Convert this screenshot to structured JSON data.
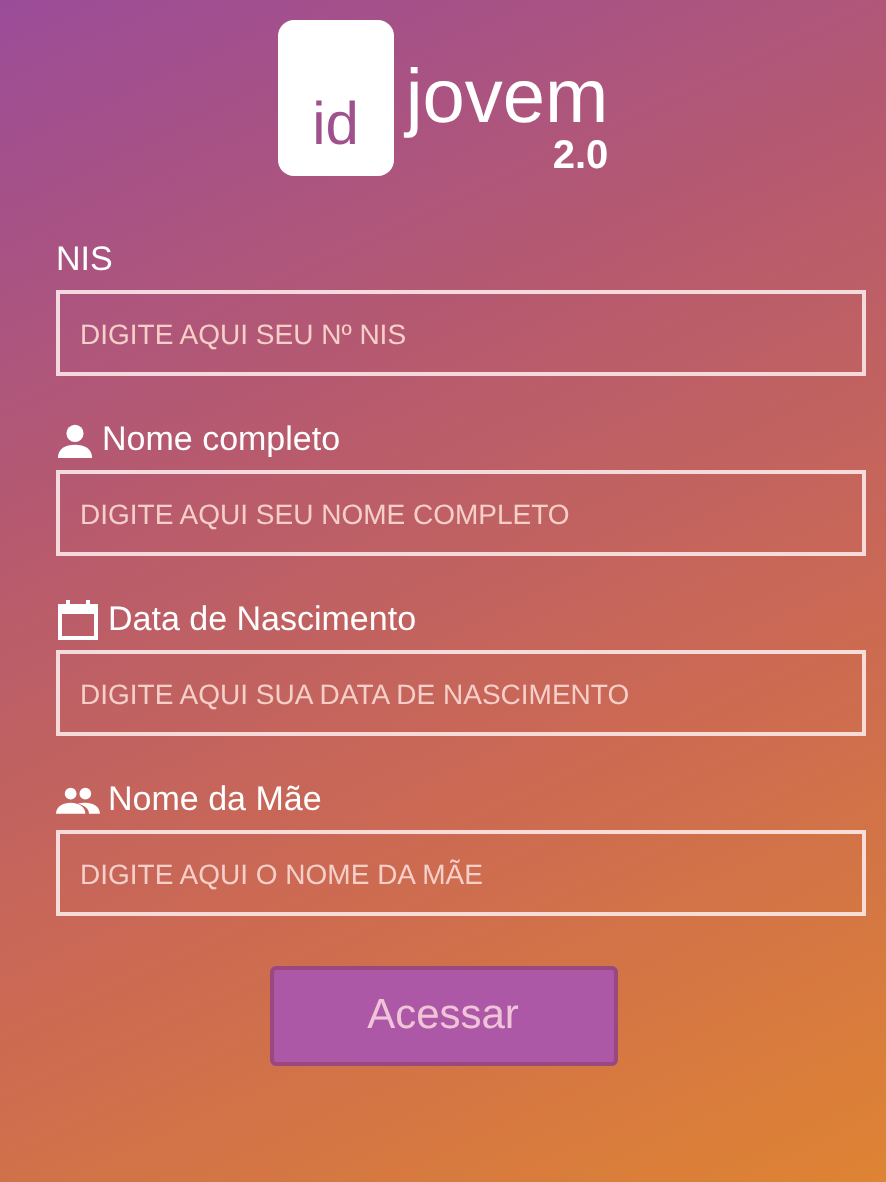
{
  "logo": {
    "mark": "id",
    "name": "jovem",
    "version": "2.0"
  },
  "fields": [
    {
      "label": "NIS",
      "kind": "plain",
      "placeholder": "DIGITE AQUI SEU Nº NIS"
    },
    {
      "label": "Nome completo",
      "kind": "person",
      "placeholder": "DIGITE AQUI SEU NOME COMPLETO"
    },
    {
      "label": "Data de Nascimento",
      "kind": "calendar",
      "placeholder": "DIGITE AQUI SUA DATA DE NASCIMENTO"
    },
    {
      "label": "Nome da Mãe",
      "kind": "people",
      "placeholder": "DIGITE AQUI O NOME DA MÃE"
    }
  ],
  "submit": "Acessar"
}
